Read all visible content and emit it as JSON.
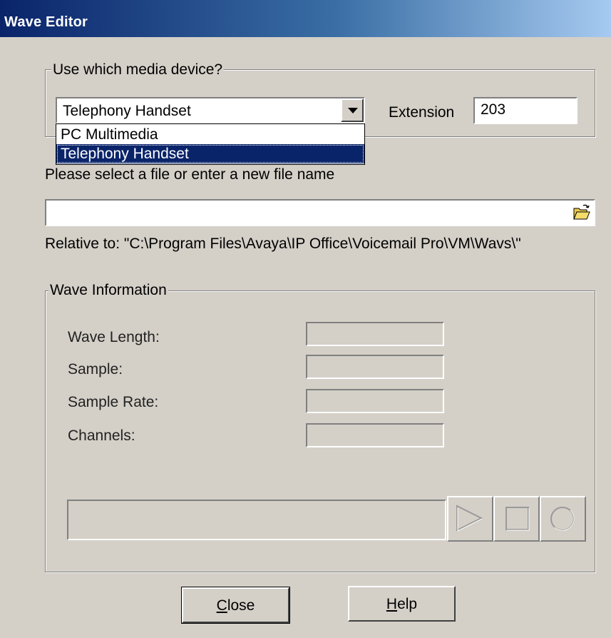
{
  "window": {
    "title": "Wave Editor"
  },
  "device_group": {
    "legend": "Use which media device?",
    "device_select": {
      "selected": "Telephony Handset",
      "options": [
        "PC Multimedia",
        "Telephony Handset"
      ],
      "highlighted": "Telephony Handset"
    },
    "extension_label": "Extension",
    "extension_value": "203"
  },
  "file": {
    "prompt": "Please select a file or enter a new file name",
    "value": "",
    "relative_to": "Relative to: \"C:\\Program Files\\Avaya\\IP Office\\Voicemail Pro\\VM\\Wavs\\\""
  },
  "wave_info": {
    "legend": "Wave Information",
    "fields": [
      {
        "label": "Wave Length:",
        "value": ""
      },
      {
        "label": "Sample:",
        "value": ""
      },
      {
        "label": "Sample Rate:",
        "value": ""
      },
      {
        "label": "Channels:",
        "value": ""
      }
    ]
  },
  "playback": {
    "progress": 0,
    "buttons": [
      "play-icon",
      "stop-icon",
      "record-icon"
    ]
  },
  "footer": {
    "close_prefix": "",
    "close_accel": "C",
    "close_rest": "lose",
    "help_prefix": "",
    "help_accel": "H",
    "help_rest": "elp"
  }
}
